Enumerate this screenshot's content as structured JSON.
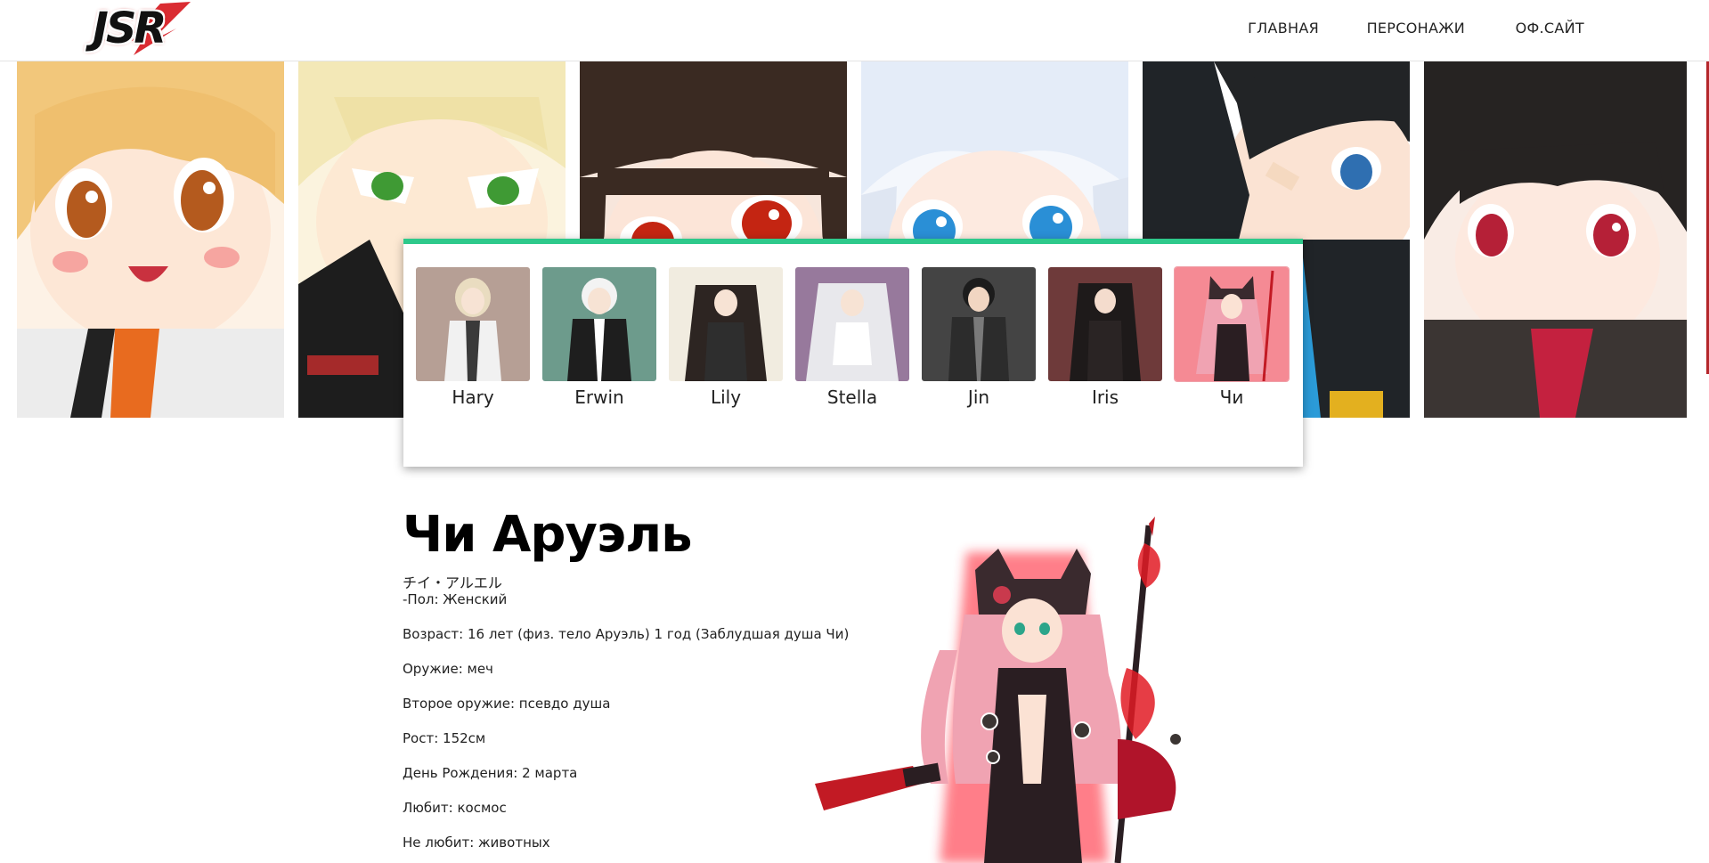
{
  "header": {
    "logo_text": "JSR",
    "nav": [
      "ГЛАВНАЯ",
      "ПЕРСОНАЖИ",
      "ОФ.САЙТ"
    ]
  },
  "hero": {
    "panels": [
      {
        "hair": "#f2c77b",
        "eye": "#b45a1e",
        "coat": "#ececec"
      },
      {
        "hair": "#f3e8b7",
        "eye": "#3f9a34",
        "coat": "#1d1d1d"
      },
      {
        "hair": "#3a2a22",
        "eye": "#c42512",
        "coat": "#2a2220"
      },
      {
        "hair": "#e4ecf8",
        "eye": "#2a8fd6",
        "coat": "#dfe6f2"
      },
      {
        "hair": "#222426",
        "eye": "#2f6fb1",
        "coat": "#202428"
      },
      {
        "hair": "#262322",
        "eye": "#b52037",
        "coat": "#3b3533"
      }
    ]
  },
  "characters": [
    {
      "name": "Hary",
      "bg": "#b69f95",
      "hair": "#e9dcc0",
      "outfit": "#f1f1f1"
    },
    {
      "name": "Erwin",
      "bg": "#6d9b8c",
      "hair": "#f3f3f3",
      "outfit": "#1e1e1e"
    },
    {
      "name": "Lily",
      "bg": "#f1ece0",
      "hair": "#2d2522",
      "outfit": "#2e2e2e"
    },
    {
      "name": "Stella",
      "bg": "#97799c",
      "hair": "#e8e8ec",
      "outfit": "#ffffff"
    },
    {
      "name": "Jin",
      "bg": "#444444",
      "hair": "#1c1c1c",
      "outfit": "#2c2c2c"
    },
    {
      "name": "Iris",
      "bg": "#6e3a3a",
      "hair": "#1e1a1a",
      "outfit": "#2a2424"
    },
    {
      "name": "Чи",
      "bg": "#f58a94",
      "hair": "#f0a3b2",
      "outfit": "#2a1e22"
    }
  ],
  "detail": {
    "title": "Чи Аруэль",
    "japanese": "チイ・アルエル",
    "gender": "-Пол: Женский",
    "stats": [
      "Возраст: 16 лет (физ. тело Аруэль) 1 год (Заблудшая душа Чи)",
      "Оружие: меч",
      "Второе оружие: псевдо душа",
      "Рост: 152см",
      "День Рождения: 2 марта",
      "Любит: космос",
      "Не любит: животных"
    ]
  },
  "colors": {
    "accent_green": "#2ec98b",
    "logo_red": "#d6151c",
    "scroll_accent": "#b4262b"
  }
}
